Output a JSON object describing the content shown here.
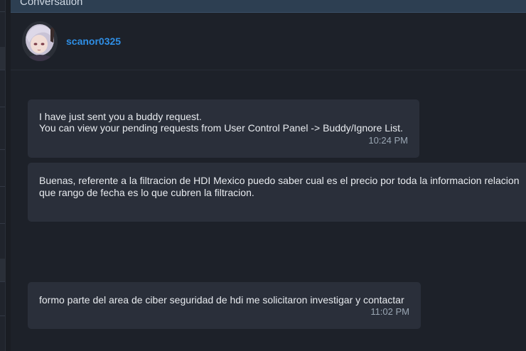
{
  "panel": {
    "title": "Conversation"
  },
  "user": {
    "username": "scanor0325",
    "avatar_icon": "anime-avatar"
  },
  "messages": [
    {
      "lines": [
        "I have just sent you a buddy request.",
        "You can view your pending requests from User Control Panel -> Buddy/Ignore List."
      ],
      "time": "10:24 PM"
    },
    {
      "lines": [
        "Buenas, referente a la filtracion de HDI Mexico puedo saber cual es el precio por toda la informacion relacion",
        "que rango de fecha es lo que cubren la filtracion."
      ],
      "time": ""
    },
    {
      "lines": [
        "formo parte del area de ciber seguridad de hdi me solicitaron investigar y contactar"
      ],
      "time": "11:02 PM"
    }
  ],
  "colors": {
    "background": "#1d2129",
    "bubble": "#2a2f3a",
    "username": "#2f8fe6",
    "header": "#2d3f52"
  }
}
